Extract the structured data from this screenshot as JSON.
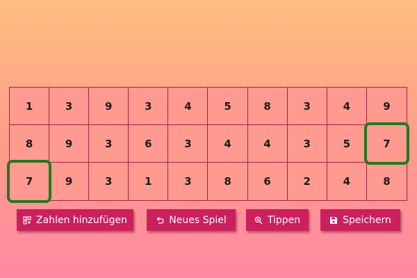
{
  "grid": {
    "rows": [
      [
        "1",
        "3",
        "9",
        "3",
        "4",
        "5",
        "8",
        "3",
        "4",
        "9"
      ],
      [
        "8",
        "9",
        "3",
        "6",
        "3",
        "4",
        "4",
        "3",
        "5",
        "7"
      ],
      [
        "7",
        "9",
        "3",
        "1",
        "3",
        "8",
        "6",
        "2",
        "4",
        "8"
      ]
    ],
    "selected": [
      [
        1,
        9
      ],
      [
        2,
        0
      ]
    ],
    "selection_color": "#1f7a1f"
  },
  "toolbar": {
    "add_numbers": {
      "label": "Zahlen hinzufügen",
      "icon": "grid-plus-icon"
    },
    "new_game": {
      "label": "Neues Spiel",
      "icon": "undo-arrow-icon"
    },
    "hint": {
      "label": "Tippen",
      "icon": "search-icon"
    },
    "save": {
      "label": "Speichern",
      "icon": "save-icon"
    }
  },
  "colors": {
    "button_bg": "#cc1f5d",
    "cell_bg": "#ff9a90",
    "grid_line": "#b01a45"
  }
}
